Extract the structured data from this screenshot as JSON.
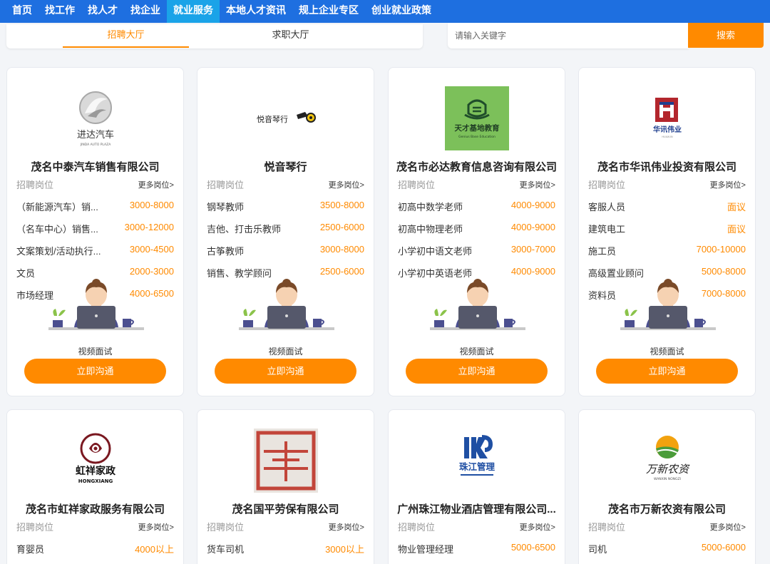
{
  "nav": [
    {
      "label": "首页",
      "active": false
    },
    {
      "label": "找工作",
      "active": false
    },
    {
      "label": "找人才",
      "active": false
    },
    {
      "label": "找企业",
      "active": false
    },
    {
      "label": "就业服务",
      "active": true
    },
    {
      "label": "本地人才资讯",
      "active": false
    },
    {
      "label": "规上企业专区",
      "active": false
    },
    {
      "label": "创业就业政策",
      "active": false
    }
  ],
  "tabs": {
    "recruit": "招聘大厅",
    "job": "求职大厅",
    "active": "recruit"
  },
  "search": {
    "placeholder": "请输入关键字",
    "button": "搜索"
  },
  "colors": {
    "accent": "#ff8a00",
    "nav_bg": "#1e6fe0",
    "nav_active": "#1aa3e8"
  },
  "card_labels": {
    "positions": "招聘岗位",
    "more": "更多岗位>",
    "video": "视频面试",
    "chat": "立即沟通"
  },
  "cards": [
    {
      "company": "茂名中泰汽车销售有限公司",
      "logo": "jinda-auto-logo",
      "logo_text": "进达汽车",
      "jobs": [
        {
          "name": "（新能源汽车）销...",
          "salary": "3000-8000"
        },
        {
          "name": "（名车中心）销售...",
          "salary": "3000-12000"
        },
        {
          "name": "文案策划/活动执行...",
          "salary": "3000-4500"
        },
        {
          "name": "文员",
          "salary": "2000-3000"
        },
        {
          "name": "市场经理",
          "salary": "4000-6500"
        }
      ]
    },
    {
      "company": "悦音琴行",
      "logo": "yueyin-piano-logo",
      "logo_text": "悦音琴行",
      "jobs": [
        {
          "name": "钢琴教师",
          "salary": "3500-8000"
        },
        {
          "name": "吉他、打击乐教师",
          "salary": "2500-6000"
        },
        {
          "name": "古筝教师",
          "salary": "3000-8000"
        },
        {
          "name": "销售、教学顾问",
          "salary": "2500-6000"
        }
      ]
    },
    {
      "company": "茂名市必达教育信息咨询有限公司",
      "logo": "tiancai-education-logo",
      "logo_text": "天才基地教育",
      "jobs": [
        {
          "name": "初高中数学老师",
          "salary": "4000-9000"
        },
        {
          "name": "初高中物理老师",
          "salary": "4000-9000"
        },
        {
          "name": "小学初中语文老师",
          "salary": "3000-7000"
        },
        {
          "name": "小学初中英语老师",
          "salary": "4000-9000"
        }
      ]
    },
    {
      "company": "茂名市华讯伟业投资有限公司",
      "logo": "huaxun-logo",
      "logo_text": "华讯伟业",
      "jobs": [
        {
          "name": "客服人员",
          "salary": "面议"
        },
        {
          "name": "建筑电工",
          "salary": "面议"
        },
        {
          "name": "施工员",
          "salary": "7000-10000"
        },
        {
          "name": "高级置业顾问",
          "salary": "5000-8000"
        },
        {
          "name": "资料员",
          "salary": "7000-8000"
        }
      ]
    },
    {
      "company": "茂名市虹祥家政服务有限公司",
      "logo": "hongxiang-logo",
      "logo_text": "虹祥家政",
      "jobs": [
        {
          "name": "育婴员",
          "salary": "4000以上"
        }
      ]
    },
    {
      "company": "茂名国平劳保有限公司",
      "logo": "guoping-seal-logo",
      "logo_text": "",
      "jobs": [
        {
          "name": "货车司机",
          "salary": "3000以上"
        }
      ]
    },
    {
      "company": "广州珠江物业酒店管理有限公司...",
      "logo": "zhujiang-logo",
      "logo_text": "珠江管理",
      "jobs": [
        {
          "name": "物业管理经理",
          "salary": "5000-6500"
        }
      ]
    },
    {
      "company": "茂名市万新农资有限公司",
      "logo": "wanxin-logo",
      "logo_text": "万新农资",
      "jobs": [
        {
          "name": "司机",
          "salary": "5000-6000"
        }
      ]
    }
  ]
}
